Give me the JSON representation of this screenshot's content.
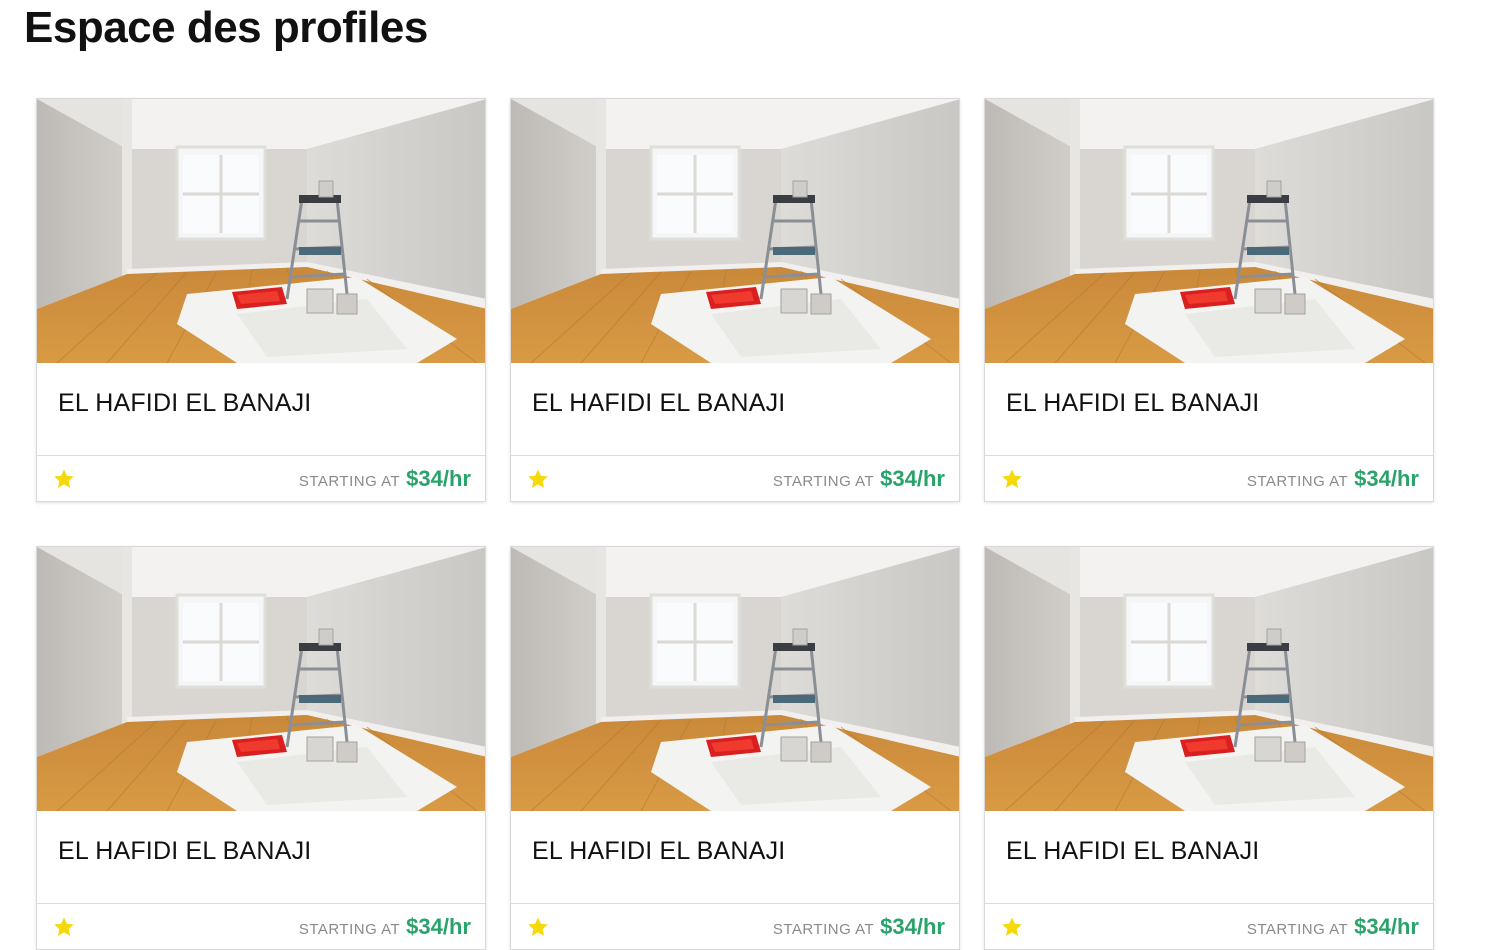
{
  "page": {
    "title": "Espace des profiles"
  },
  "theme": {
    "price_color": "#2aa36b",
    "star_color": "#f5d90a"
  },
  "profiles": [
    {
      "name": "EL HAFIDI EL BANAJI",
      "rating_icon": "star-icon",
      "price_label": "STARTING AT",
      "price": "$34/hr"
    },
    {
      "name": "EL HAFIDI EL BANAJI",
      "rating_icon": "star-icon",
      "price_label": "STARTING AT",
      "price": "$34/hr"
    },
    {
      "name": "EL HAFIDI EL BANAJI",
      "rating_icon": "star-icon",
      "price_label": "STARTING AT",
      "price": "$34/hr"
    },
    {
      "name": "EL HAFIDI EL BANAJI",
      "rating_icon": "star-icon",
      "price_label": "STARTING AT",
      "price": "$34/hr"
    },
    {
      "name": "EL HAFIDI EL BANAJI",
      "rating_icon": "star-icon",
      "price_label": "STARTING AT",
      "price": "$34/hr"
    },
    {
      "name": "EL HAFIDI EL BANAJI",
      "rating_icon": "star-icon",
      "price_label": "STARTING AT",
      "price": "$34/hr"
    }
  ]
}
